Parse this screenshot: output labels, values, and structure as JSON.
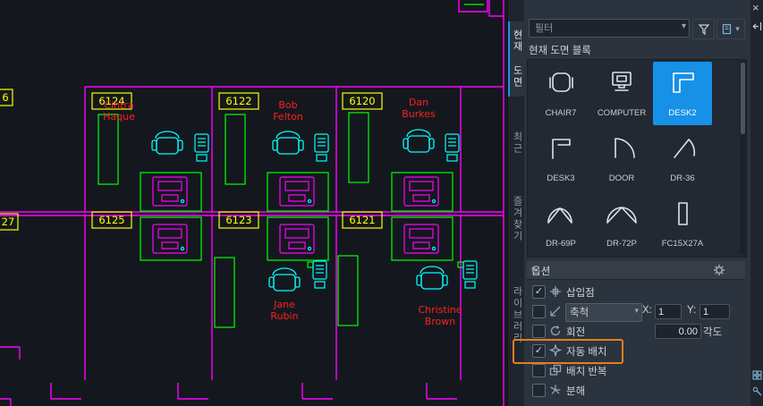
{
  "drawing": {
    "rooms": [
      {
        "id": "6124"
      },
      {
        "id": "6122"
      },
      {
        "id": "6120"
      },
      {
        "id": "6125"
      },
      {
        "id": "6123"
      },
      {
        "id": "6121"
      },
      {
        "id": "6"
      },
      {
        "id": "27"
      }
    ],
    "occupants": [
      {
        "lines": [
          "Cintra",
          "Haque"
        ]
      },
      {
        "lines": [
          "Bob",
          "Felton"
        ]
      },
      {
        "lines": [
          "Dan",
          "Burkes"
        ]
      },
      {
        "lines": [
          "Jane",
          "Rubin"
        ]
      },
      {
        "lines": [
          "Christine",
          "Brown"
        ]
      }
    ],
    "colors": {
      "wall": "#ff00ff",
      "tag": "#ffff00",
      "name": "#ff1f1f",
      "furniture_green": "#00ff00",
      "furniture_cyan": "#00ffff",
      "background": "#14181e"
    }
  },
  "panel": {
    "filter_placeholder": "필터",
    "section_label": "현재 도면 블록",
    "tabs": [
      {
        "label": "현재 도면",
        "active": true
      },
      {
        "label": "최근",
        "active": false
      },
      {
        "label": "즐겨찾기",
        "active": false
      },
      {
        "label": "라이브러리",
        "active": false
      }
    ],
    "blocks": [
      {
        "name": "CHAIR7",
        "selected": false
      },
      {
        "name": "COMPUTER",
        "selected": false
      },
      {
        "name": "DESK2",
        "selected": true
      },
      {
        "name": "DESK3",
        "selected": false
      },
      {
        "name": "DOOR",
        "selected": false
      },
      {
        "name": "DR-36",
        "selected": false
      },
      {
        "name": "DR-69P",
        "selected": false
      },
      {
        "name": "DR-72P",
        "selected": false
      },
      {
        "name": "FC15X27A",
        "selected": false
      }
    ],
    "options": {
      "header": "옵션",
      "rows": [
        {
          "label": "삽입점",
          "checked": true
        },
        {
          "label": "축척",
          "checked": false
        },
        {
          "label": "회전",
          "checked": false
        },
        {
          "label": "자동 배치",
          "checked": true,
          "highlighted": true
        },
        {
          "label": "배치 반복",
          "checked": false
        },
        {
          "label": "분해",
          "checked": false
        }
      ],
      "x_label": "X:",
      "x_value": "1",
      "y_label": "Y:",
      "y_value": "1",
      "angle_value": "0.00",
      "angle_label": "각도",
      "check_glyph": "✓"
    },
    "close_glyph": "×",
    "accent_blue": "#1790e8",
    "highlight_orange": "#e0801f"
  }
}
